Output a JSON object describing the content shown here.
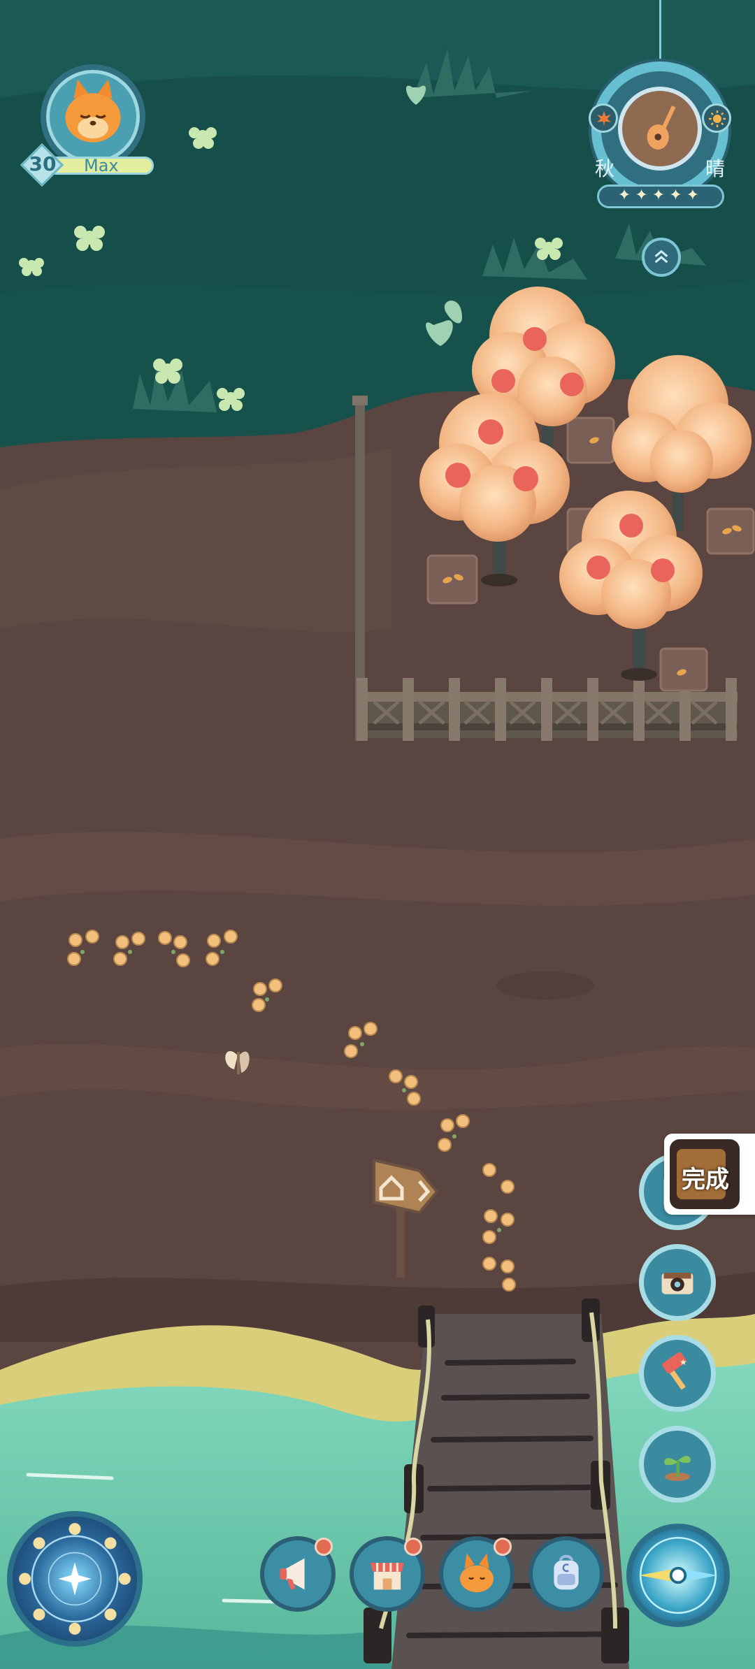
{
  "player": {
    "level": "30",
    "level_status": "Max",
    "avatar_icon": "orange-fox-avatar-icon"
  },
  "weather": {
    "season": "秋",
    "condition": "晴",
    "rating": 5,
    "center_icon": "guitar-icon",
    "season_icon": "maple-leaf-icon",
    "condition_icon": "sun-icon",
    "expand_icon": "double-chevron-up-icon"
  },
  "popup": {
    "label": "完成"
  },
  "side_buttons": [
    {
      "name": "photo-album-button",
      "icon": "album-icon"
    },
    {
      "name": "camera-button",
      "icon": "camera-icon"
    },
    {
      "name": "hammer-button",
      "icon": "hammer-icon"
    },
    {
      "name": "sprout-button",
      "icon": "sprout-icon"
    }
  ],
  "bottom_bar": [
    {
      "name": "announcement-button",
      "icon": "megaphone-icon",
      "notification": true
    },
    {
      "name": "shop-button",
      "icon": "shop-icon",
      "notification": true
    },
    {
      "name": "character-button",
      "icon": "orange-fox-icon",
      "notification": true
    },
    {
      "name": "backpack-button",
      "icon": "backpack-icon",
      "notification": false
    }
  ],
  "moon_dial_icon": "moon-phase-dial-icon",
  "compass_icon": "compass-icon",
  "signpost_icon": "home-arrow-icon",
  "colors": {
    "grass": "#164f4a",
    "dirt": "#5a4540",
    "water": "#74cdb1",
    "sand": "#ddd27e",
    "tree_canopy": "#f0b482",
    "apple": "#e9645a",
    "hud_ring": "#6cb8c6"
  }
}
